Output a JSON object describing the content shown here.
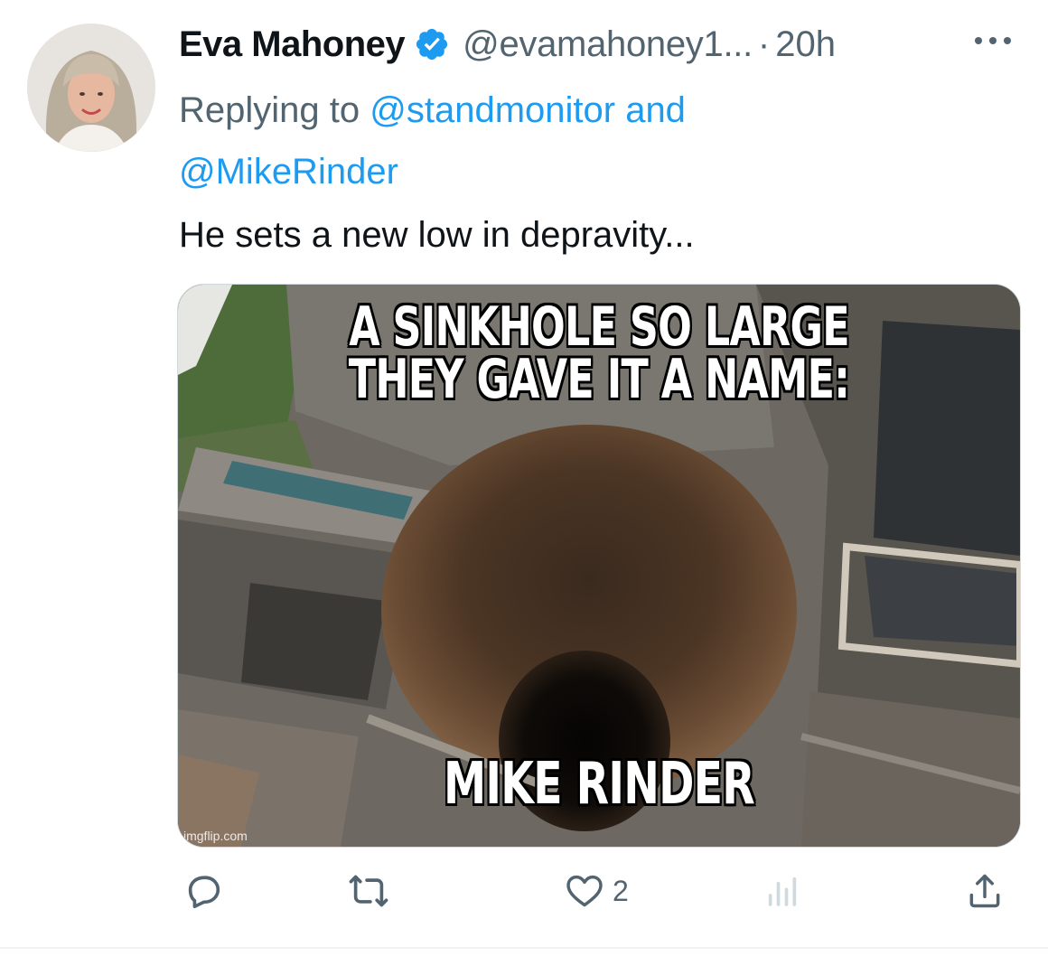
{
  "author": {
    "display_name": "Eva Mahoney",
    "handle": "@evamahoney1...",
    "separator": "·",
    "time": "20h",
    "verified": true
  },
  "reply": {
    "prefix": "Replying to ",
    "mention_1": "@standmonitor",
    "conjunction": " and",
    "mention_2": "@MikeRinder"
  },
  "tweet": {
    "text": "He sets a new low in depravity..."
  },
  "media": {
    "top_caption_line1": "A SINKHOLE SO LARGE",
    "top_caption_line2": "THEY GAVE IT A NAME:",
    "bottom_caption": "MIKE RINDER",
    "watermark": "imgflip.com"
  },
  "actions": {
    "reply_icon": "reply-bubble-icon",
    "retweet_icon": "retweet-icon",
    "like_icon": "heart-icon",
    "like_count": "2",
    "views_icon": "views-chart-icon",
    "share_icon": "share-upload-icon"
  },
  "colors": {
    "link": "#1d9bf0",
    "secondary_text": "#536471",
    "primary_text": "#0f1419",
    "verified_badge": "#1d9bf0"
  }
}
